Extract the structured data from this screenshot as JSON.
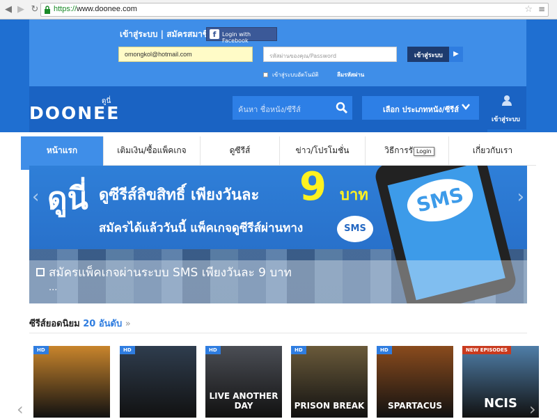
{
  "browser": {
    "url_scheme": "https://",
    "url_host": "www.doonee.com"
  },
  "login": {
    "title": "เข้าสู่ระบบ | สมัครสมาชิก",
    "facebook_label": "Login with Facebook",
    "email_value": "omongkol@hotmail.com",
    "password_placeholder": "รหัสผ่านของคุณ/Password",
    "submit_label": "เข้าสู่ระบบ",
    "remember_label": "เข้าสู่ระบบอัตโนมัติ",
    "forgot_label": "ลืมรหัสผ่าน"
  },
  "header": {
    "logo_text": "DOONEE",
    "logo_sub": "ดูนี่",
    "search_placeholder": "ค้นหา ชื่อหนัง/ซีรีส์",
    "category_label": "เลือก ประเภทหนัง/ซีรีส์",
    "user_label": "เข้าสู่ระบบ"
  },
  "nav": {
    "items": [
      "หน้าแรก",
      "เติมเงิน/ซื้อแพ็คเกจ",
      "ดูซีรีส์",
      "ข่าว/โปรโมชั่น",
      "วิธีการรับชม",
      "เกี่ยวกับเรา"
    ],
    "tooltip": "Login"
  },
  "banner": {
    "brand": "ดูนี่",
    "line1": "ดูซีรีส์ลิขสิทธิ์ เพียงวันละ",
    "price": "9",
    "unit": "บาท",
    "line2": "สมัครได้แล้ววันนี้ แพ็คเกจดูซีรีส์ผ่านทาง",
    "sms_badge": "SMS",
    "phone_text": "SMS",
    "caption": "สมัครแพ็คเกจผ่านระบบ SMS เพียงวันละ 9 บาท",
    "ellipsis": "..."
  },
  "popular": {
    "title": "ซีรีส์ยอดนิยม",
    "count": "20 อันดับ",
    "more": "»",
    "posters": [
      {
        "badge": "HD",
        "title": "",
        "color": "#c9852c"
      },
      {
        "badge": "HD",
        "title": "",
        "color": "#2f3d4e"
      },
      {
        "badge": "HD",
        "title": "LIVE ANOTHER DAY",
        "color": "#4b4e55"
      },
      {
        "badge": "HD",
        "title": "PRISON BREAK",
        "color": "#6a5a3a"
      },
      {
        "badge": "HD",
        "title": "SPARTACUS",
        "color": "#8a4b1d"
      },
      {
        "badge": "NEW EPISODES",
        "title": "NCIS",
        "color": "#4f7ea8"
      }
    ]
  },
  "colors": {
    "brand_blue": "#1f6fd1",
    "panel_blue": "#3f8ee8",
    "price_yellow": "#fff21f"
  }
}
